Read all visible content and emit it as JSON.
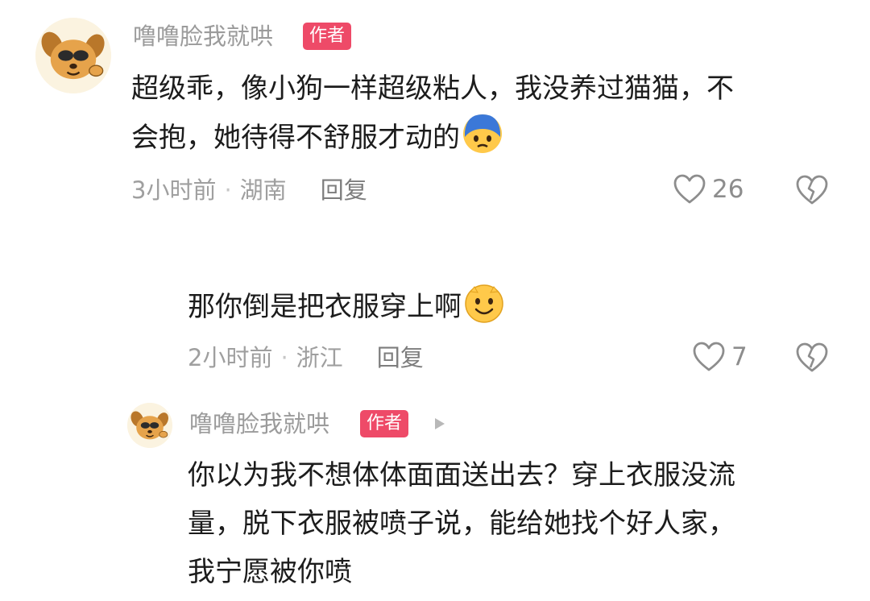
{
  "comment": {
    "author": "噜噜脸我就哄",
    "badge": "作者",
    "text": "超级乖，像小狗一样超级粘人，我没养过猫猫，不会抱，她待得不舒服才动的",
    "text_line1": "超级乖，像小狗一样超级粘人，我没养过猫猫，不",
    "text_line2": "会抱，她待得不舒服才动的",
    "trailing_emoji": "crying-emoji",
    "time": "3小时前",
    "separator": "·",
    "location": "湖南",
    "reply_label": "回复",
    "like_count": "26"
  },
  "reply1": {
    "text": "那你倒是把衣服穿上啊",
    "trailing_emoji": "smile-emoji",
    "time": "2小时前",
    "separator": "·",
    "location": "浙江",
    "reply_label": "回复",
    "like_count": "7"
  },
  "reply2": {
    "author": "噜噜脸我就哄",
    "badge": "作者",
    "line1": "你以为我不想体体面面送出去？穿上衣服没流",
    "line2": "量，脱下衣服被喷子说，能给她找个好人家，",
    "line3": "我宁愿被你喷"
  },
  "colors": {
    "badge": "#ee4a68",
    "meta": "#9f9f9f",
    "text": "#1c1c1c"
  }
}
